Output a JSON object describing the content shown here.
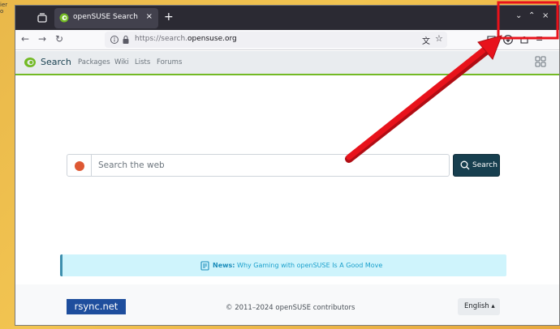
{
  "desktop": {
    "corner_text_1": "ier",
    "corner_text_2": "o"
  },
  "browser": {
    "tab": {
      "title": "openSUSE Search",
      "close_glyph": "×"
    },
    "new_tab_glyph": "+",
    "window_controls": {
      "minimize": "⌄",
      "maximize": "⌃",
      "close": "×"
    },
    "nav": {
      "back": "←",
      "forward": "→",
      "reload": "↻"
    },
    "url": {
      "prefix": "https://search.",
      "domain": "opensuse.org"
    },
    "icons": [
      "tab-list-icon",
      "translate-icon",
      "bookmark-star-icon",
      "pocket-icon",
      "downloads-icon",
      "extensions-icon",
      "menu-icon"
    ]
  },
  "site": {
    "brand": "Search",
    "nav": [
      "Packages",
      "Wiki",
      "Lists",
      "Forums"
    ],
    "search": {
      "placeholder": "Search the web",
      "button_label": "Search"
    },
    "news": {
      "label": "News:",
      "text": "Why Gaming with openSUSE Is A Good Move"
    },
    "footer": {
      "rsync": "rsync.net",
      "copyright": "© 2011–2024 openSUSE contributors",
      "language": "English ▴"
    }
  },
  "colors": {
    "accent_green": "#73ba25",
    "brand_navy": "#173f4f",
    "annotation_red": "#e8121b",
    "info_blue": "#cff4fc"
  }
}
